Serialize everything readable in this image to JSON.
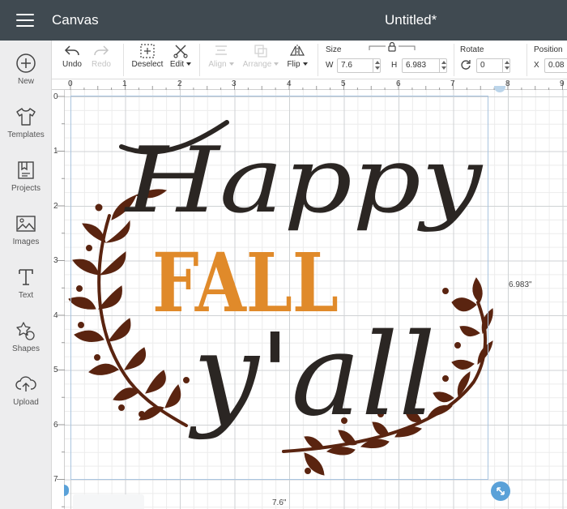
{
  "titlebar": {
    "app_title": "Canvas",
    "document_title": "Untitled*"
  },
  "left_rail": {
    "items": [
      {
        "label": "New",
        "icon": "plus-circle-icon"
      },
      {
        "label": "Templates",
        "icon": "tshirt-icon"
      },
      {
        "label": "Projects",
        "icon": "projects-icon"
      },
      {
        "label": "Images",
        "icon": "image-icon"
      },
      {
        "label": "Text",
        "icon": "text-icon"
      },
      {
        "label": "Shapes",
        "icon": "shapes-icon"
      },
      {
        "label": "Upload",
        "icon": "upload-icon"
      }
    ]
  },
  "toolbar": {
    "undo_label": "Undo",
    "redo_label": "Redo",
    "deselect_label": "Deselect",
    "edit_label": "Edit",
    "align_label": "Align",
    "arrange_label": "Arrange",
    "flip_label": "Flip",
    "size": {
      "label": "Size",
      "w_label": "W",
      "w_value": "7.6",
      "h_label": "H",
      "h_value": "6.983"
    },
    "rotate": {
      "label": "Rotate",
      "value": "0"
    },
    "position": {
      "label": "Position",
      "x_label": "X",
      "x_value": "0.08"
    }
  },
  "rulers": {
    "top": [
      "0",
      "1",
      "2",
      "3",
      "4",
      "5",
      "6",
      "7",
      "8",
      "9"
    ],
    "left": [
      "0",
      "1",
      "2",
      "3",
      "4",
      "5",
      "6",
      "7"
    ]
  },
  "selection": {
    "width_label": "7.6\"",
    "height_label": "6.983\""
  },
  "design": {
    "line1": "Happy",
    "line2": "FALL",
    "line3": "y'all",
    "colors": {
      "script": "#2b2623",
      "fall": "#e08a2a",
      "leaves": "#5a2410",
      "selection": "#a9c4df",
      "accent": "#5aa1d8"
    }
  }
}
